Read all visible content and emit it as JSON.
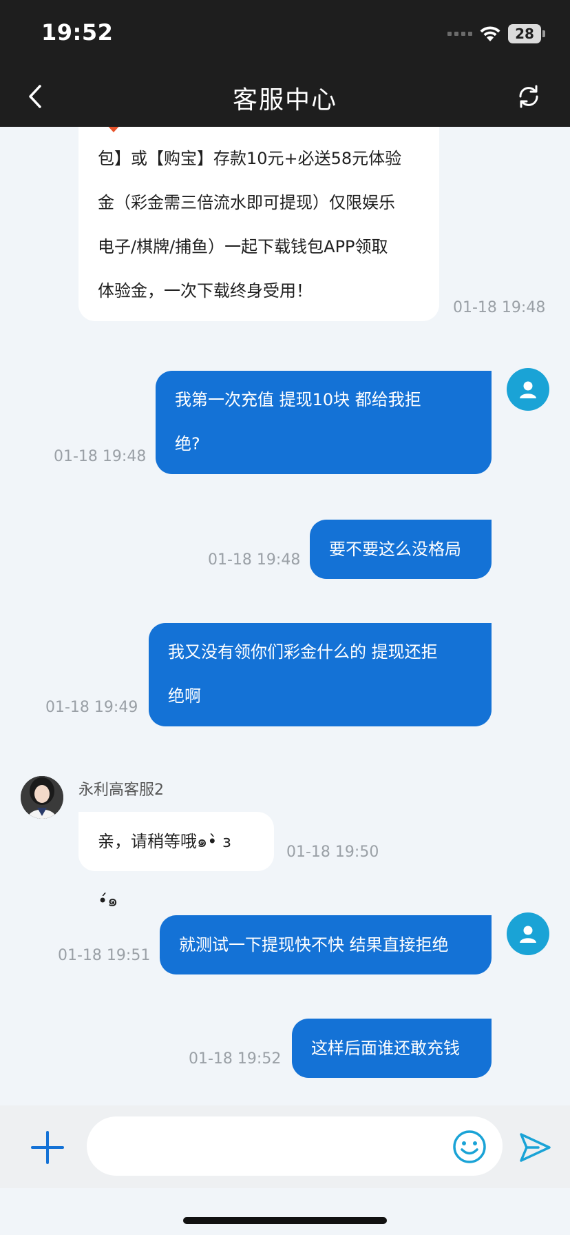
{
  "status_bar": {
    "time": "19:52",
    "battery": "28",
    "icons": [
      "signal-icon",
      "wifi-icon",
      "battery-icon"
    ]
  },
  "header": {
    "title": "客服中心",
    "left_icon": "back-icon",
    "right_icon": "refresh-icon"
  },
  "colors": {
    "header_bg": "#1e1e1e",
    "outgoing_bubble": "#1472d6",
    "incoming_bubble": "#ffffff",
    "chat_bg": "#f1f5f9",
    "accent": "#1aa3d6"
  },
  "messages": [
    {
      "direction": "in",
      "lines": [
        "包】或【购宝】存款10元+必送58元体验",
        "金（彩金需三倍流水即可提现）仅限娱乐",
        "电子/棋牌/捕鱼）一起下载钱包APP领取",
        "体验金，一次下载终身受用！"
      ],
      "time": "01-18 19:48"
    },
    {
      "direction": "out",
      "lines": [
        "我第一次充值 提现10块 都给我拒",
        "绝?"
      ],
      "time": "01-18 19:48"
    },
    {
      "direction": "out",
      "lines": [
        "要不要这么没格局"
      ],
      "time": "01-18 19:48"
    },
    {
      "direction": "out",
      "lines": [
        "我又没有领你们彩金什么的 提现还拒",
        "绝啊"
      ],
      "time": "01-18 19:49"
    },
    {
      "direction": "in",
      "sender": "永利高客服2",
      "lines": [
        "亲，请稍等哦๑•̀ з •́๑"
      ],
      "time": "01-18 19:50"
    },
    {
      "direction": "out",
      "lines": [
        "就测试一下提现快不快 结果直接拒绝"
      ],
      "time": "01-18 19:51"
    },
    {
      "direction": "out",
      "lines": [
        "这样后面谁还敢充钱"
      ],
      "time": "01-18 19:52"
    }
  ],
  "input_bar": {
    "placeholder": "",
    "value": "",
    "icons": [
      "plus-icon",
      "emoji-icon",
      "send-icon"
    ]
  }
}
